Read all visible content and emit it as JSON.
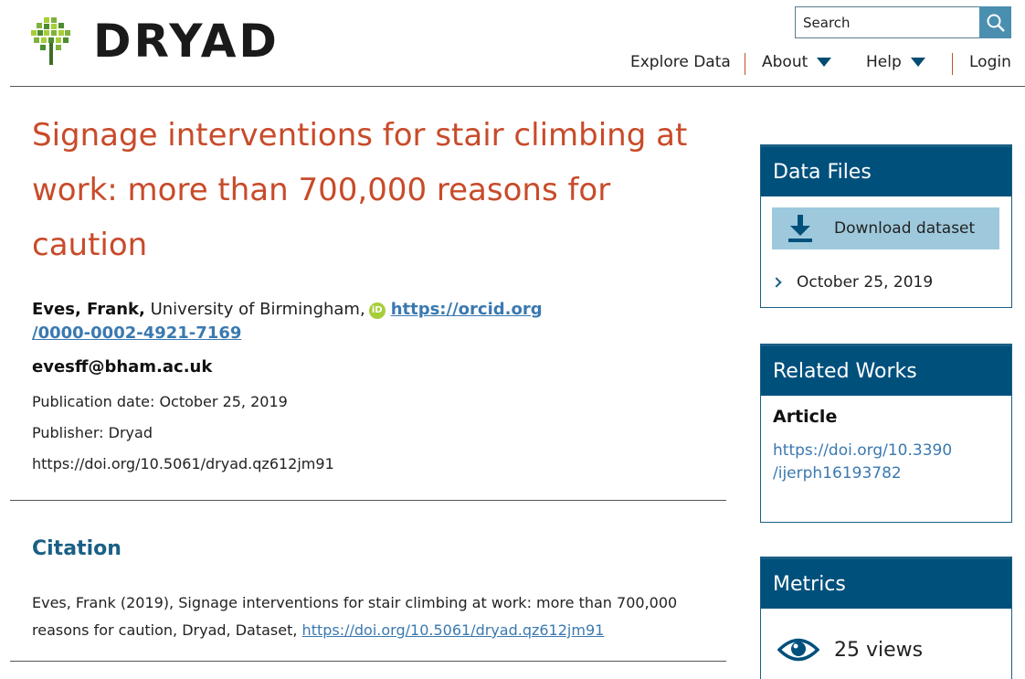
{
  "brand": {
    "name": "DRYAD"
  },
  "search": {
    "placeholder": "Search"
  },
  "nav": {
    "explore": "Explore Data",
    "about": "About",
    "help": "Help",
    "login": "Login"
  },
  "colors": {
    "accent": "#c84b2a",
    "primary": "#00507c",
    "link": "#3a79b0",
    "button": "#9ec9dc"
  },
  "dataset": {
    "title": "Signage interventions for stair climbing at work: more than 700,000 reasons for caution",
    "author_name": "Eves, Frank,",
    "affiliation": "University of Birmingham,",
    "orcid_url_1": "https://orcid.org",
    "orcid_url_2": "/0000-0002-4921-7169",
    "email": "evesff@bham.ac.uk",
    "publication_date": "Publication date: October 25, 2019",
    "publisher": "Publisher: Dryad",
    "doi": "https://doi.org/10.5061/dryad.qz612jm91"
  },
  "citation": {
    "heading": "Citation",
    "text": "Eves, Frank (2019), Signage interventions for stair climbing at work: more than 700,000 reasons for caution, Dryad, Dataset,",
    "link": "https://doi.org/10.5061/dryad.qz612jm91"
  },
  "sidebar": {
    "data_files": {
      "heading": "Data Files",
      "download_label": "Download dataset",
      "version_date": "October 25, 2019"
    },
    "related_works": {
      "heading": "Related Works",
      "type": "Article",
      "link_1": "https://doi.org/10.3390",
      "link_2": "/ijerph16193782"
    },
    "metrics": {
      "heading": "Metrics",
      "views": "25 views"
    }
  },
  "icons": [
    "dryad-tree-logo",
    "search-icon",
    "caret-down-icon",
    "orcid-icon",
    "download-icon",
    "chevron-right-icon",
    "eye-icon"
  ]
}
